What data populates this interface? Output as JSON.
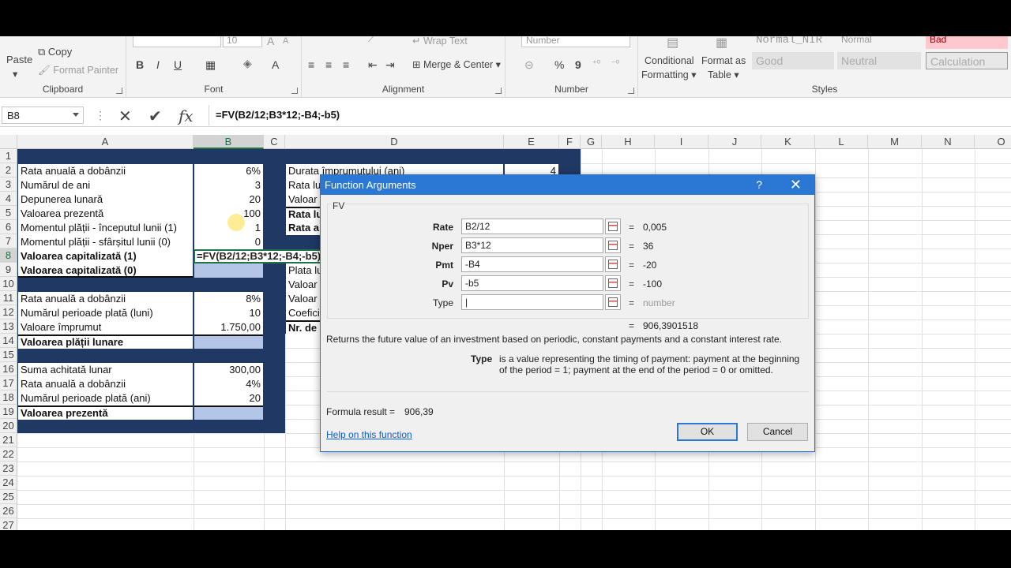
{
  "ribbon": {
    "clipboard": {
      "paste": "Paste",
      "copy": "Copy",
      "format_painter": "Format Painter",
      "label": "Clipboard"
    },
    "font": {
      "size": "10",
      "bold": "B",
      "italic": "I",
      "underline": "U",
      "font_color": "A",
      "grow": "A",
      "shrink": "A",
      "label": "Font"
    },
    "alignment": {
      "wrap": "Wrap Text",
      "merge": "Merge & Center",
      "label": "Alignment"
    },
    "number": {
      "format": "Number",
      "percent": "%",
      "comma": "9",
      "label": "Number"
    },
    "styles": {
      "conditional_line1": "Conditional",
      "conditional_line2": "Formatting",
      "format_table_line1": "Format as",
      "format_table_line2": "Table",
      "cells": [
        "Normal_NIR",
        "Normal",
        "Bad",
        "Good",
        "Neutral",
        "Calculation"
      ],
      "label": "Styles"
    }
  },
  "formula_bar": {
    "name_box": "B8",
    "cancel": "✕",
    "enter": "✔",
    "fx": "fx",
    "formula": "=FV(B2/12;B3*12;-B4;-b5)"
  },
  "columns": [
    "A",
    "B",
    "C",
    "D",
    "E",
    "F",
    "G",
    "H",
    "I",
    "J",
    "K",
    "L",
    "M",
    "N",
    "O"
  ],
  "rows": [
    "1",
    "2",
    "3",
    "4",
    "5",
    "6",
    "7",
    "8",
    "9",
    "10",
    "11",
    "12",
    "13",
    "14",
    "15",
    "16",
    "17",
    "18",
    "19",
    "20",
    "21",
    "22",
    "23",
    "24",
    "25",
    "26",
    "27"
  ],
  "sheet": {
    "a2": "Rata anuală a dobânzii",
    "b2": "6%",
    "a3": "Numărul de ani",
    "b3": "3",
    "a4": "Depunerea lunară",
    "b4": "20",
    "a5": "Valoarea prezentă",
    "b5": "100",
    "a6": "Momentul plății - începutul lunii (1)",
    "b6": "1",
    "a7": "Momentul plății - sfârșitul lunii (0)",
    "b7": "0",
    "a8": "Valoarea capitalizată (1)",
    "b8_edit": "=FV(B2/12;B3*12;-B4;-b5)",
    "a9": "Valoarea capitalizată (0)",
    "a11": "Rata anuală a dobânzii",
    "b11": "8%",
    "a12": "Numărul perioade plată (luni)",
    "b12": "10",
    "a13": "Valoare împrumut",
    "b13": "1.750,00",
    "a14": "Valoarea plății lunare",
    "a16": "Suma achitată lunar",
    "b16": "300,00",
    "a17": "Rata anuală a dobânzii",
    "b17": "4%",
    "a18": "Numărul perioade plată (ani)",
    "b18": "20",
    "a19": "Valoarea prezentă",
    "d2": "Durata împrumutului (ani)",
    "e2": "4",
    "d3": "Rata lu",
    "d4": "Valoar",
    "d5": "Rata lu",
    "d6": "Rata a",
    "d9": "Plata lu",
    "d10": "Valoar",
    "d11": "Valoar",
    "d12": "Coefici",
    "d13": "Nr. de"
  },
  "dialog": {
    "title": "Function Arguments",
    "help": "?",
    "close": "✕",
    "function_name": "FV",
    "args": [
      {
        "label": "Rate",
        "value": "B2/12",
        "result": "0,005"
      },
      {
        "label": "Nper",
        "value": "B3*12",
        "result": "36"
      },
      {
        "label": "Pmt",
        "value": "-B4",
        "result": "-20"
      },
      {
        "label": "Pv",
        "value": "-b5",
        "result": "-100"
      },
      {
        "label": "Type",
        "value": "|",
        "result": "number"
      }
    ],
    "equals": "=",
    "total_result": "906,3901518",
    "description": "Returns the future value of an investment based on periodic, constant payments and a constant interest rate.",
    "param_name": "Type",
    "param_desc_line1": "is a value representing the timing of payment: payment at the beginning",
    "param_desc_line2": "of the period = 1; payment at the end of the period = 0 or omitted.",
    "formula_result_label": "Formula result =",
    "formula_result_value": "906,39",
    "help_link": "Help on this function",
    "ok": "OK",
    "cancel": "Cancel"
  }
}
